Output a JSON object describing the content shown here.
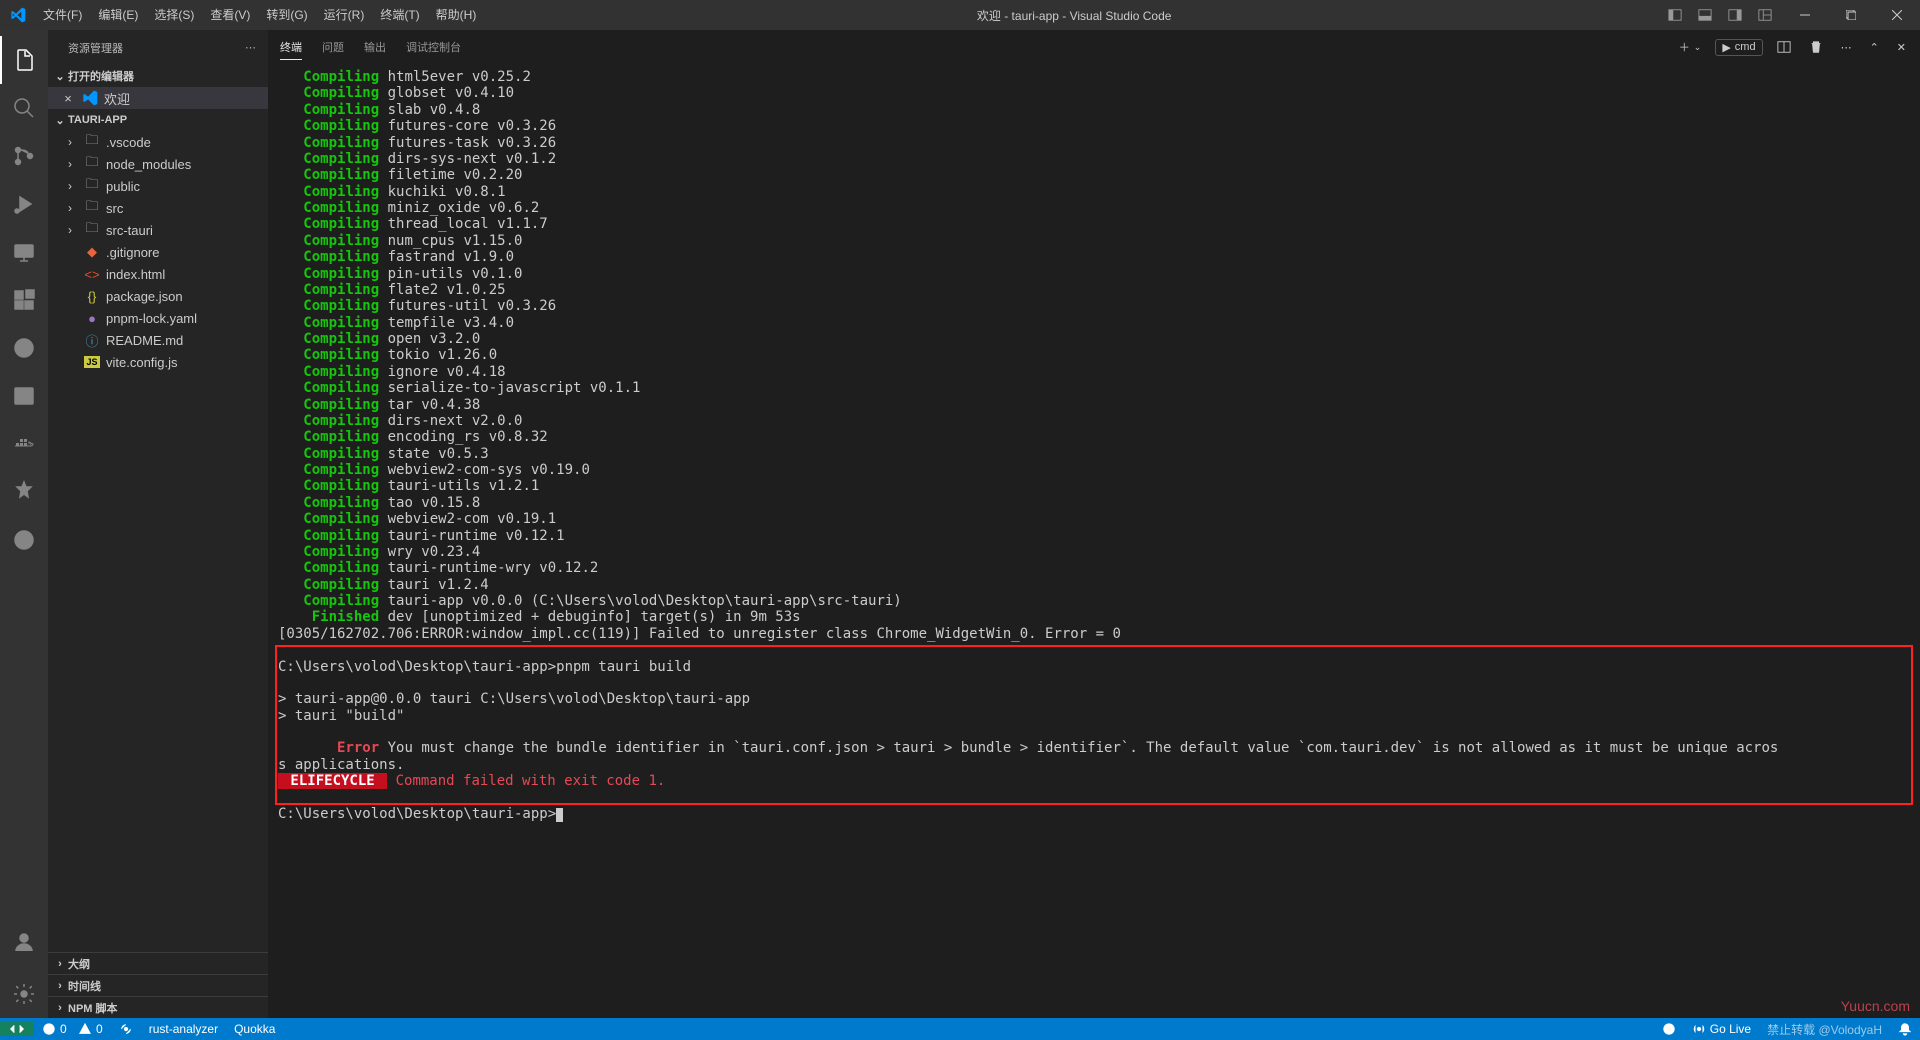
{
  "title": "欢迎 - tauri-app - Visual Studio Code",
  "menu": [
    "文件(F)",
    "编辑(E)",
    "选择(S)",
    "查看(V)",
    "转到(G)",
    "运行(R)",
    "终端(T)",
    "帮助(H)"
  ],
  "sidebar": {
    "title": "资源管理器",
    "openEditors": {
      "label": "打开的编辑器",
      "item": "欢迎"
    },
    "project": "TAURI-APP",
    "tree": [
      {
        "icon": "folder",
        "label": ".vscode",
        "chev": "›"
      },
      {
        "icon": "folder",
        "label": "node_modules",
        "chev": "›"
      },
      {
        "icon": "folder",
        "label": "public",
        "chev": "›"
      },
      {
        "icon": "folder",
        "label": "src",
        "chev": "›"
      },
      {
        "icon": "folder",
        "label": "src-tauri",
        "chev": "›"
      },
      {
        "icon": "git",
        "label": ".gitignore",
        "chev": ""
      },
      {
        "icon": "html",
        "label": "index.html",
        "chev": ""
      },
      {
        "icon": "json",
        "label": "package.json",
        "chev": ""
      },
      {
        "icon": "yaml",
        "label": "pnpm-lock.yaml",
        "chev": ""
      },
      {
        "icon": "readme",
        "label": "README.md",
        "chev": ""
      },
      {
        "icon": "js",
        "label": "vite.config.js",
        "chev": ""
      }
    ],
    "collapsed": [
      "大纲",
      "时间线",
      "NPM 脚本"
    ]
  },
  "panel": {
    "tabs": [
      "终端",
      "问题",
      "输出",
      "调试控制台"
    ],
    "shellLabel": "cmd"
  },
  "terminal": {
    "compiling_kw": "Compiling",
    "finished_kw": "Finished",
    "crates": [
      "html5ever v0.25.2",
      "globset v0.4.10",
      "slab v0.4.8",
      "futures-core v0.3.26",
      "futures-task v0.3.26",
      "dirs-sys-next v0.1.2",
      "filetime v0.2.20",
      "kuchiki v0.8.1",
      "miniz_oxide v0.6.2",
      "thread_local v1.1.7",
      "num_cpus v1.15.0",
      "fastrand v1.9.0",
      "pin-utils v0.1.0",
      "flate2 v1.0.25",
      "futures-util v0.3.26",
      "tempfile v3.4.0",
      "open v3.2.0",
      "tokio v1.26.0",
      "ignore v0.4.18",
      "serialize-to-javascript v0.1.1",
      "tar v0.4.38",
      "dirs-next v2.0.0",
      "encoding_rs v0.8.32",
      "state v0.5.3",
      "webview2-com-sys v0.19.0",
      "tauri-utils v1.2.1",
      "tao v0.15.8",
      "webview2-com v0.19.1",
      "tauri-runtime v0.12.1",
      "wry v0.23.4",
      "tauri-runtime-wry v0.12.2",
      "tauri v1.2.4",
      "tauri-app v0.0.0 (C:\\Users\\volod\\Desktop\\tauri-app\\src-tauri)"
    ],
    "finished": "dev [unoptimized + debuginfo] target(s) in 9m 53s",
    "logline": "[0305/162702.706:ERROR:window_impl.cc(119)] Failed to unregister class Chrome_WidgetWin_0. Error = 0",
    "prompt1": "C:\\Users\\volod\\Desktop\\tauri-app>pnpm tauri build",
    "run1": "> tauri-app@0.0.0 tauri C:\\Users\\volod\\Desktop\\tauri-app",
    "run2": "> tauri \"build\"",
    "error_kw": "Error",
    "error_msg": " You must change the bundle identifier in `tauri.conf.json > tauri > bundle > identifier`. The default value `com.tauri.dev` is not allowed as it must be unique acros",
    "error_msg2": "s applications.",
    "lifecycle": " ELIFECYCLE ",
    "lifecycle_msg": " Command failed with exit code 1.",
    "prompt2": "C:\\Users\\volod\\Desktop\\tauri-app>"
  },
  "statusbar": {
    "errors": "0",
    "warnings": "0",
    "rust": "rust-analyzer",
    "quokka": "Quokka",
    "golive": "Go Live",
    "watermark": "禁止转载 @VolodyaH"
  },
  "watermark": "Yuucn.com"
}
